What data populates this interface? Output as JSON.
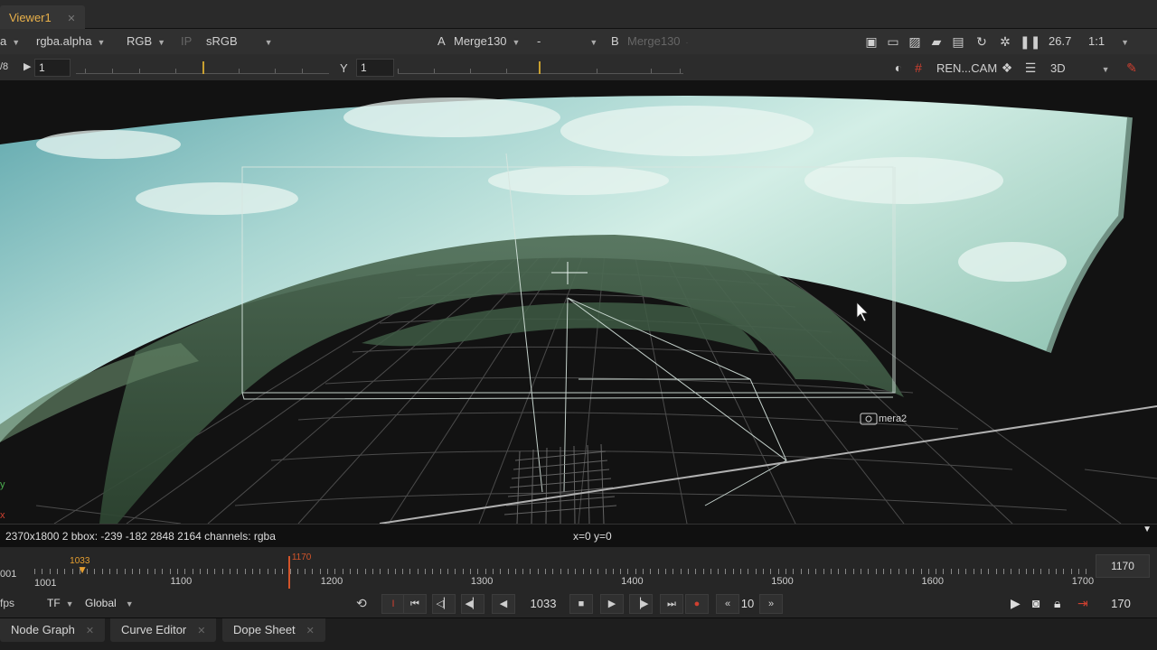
{
  "tab": {
    "title": "Viewer1",
    "close": "✕"
  },
  "toolbar1": {
    "channel_left": "a",
    "channels": "rgba.alpha",
    "display": "RGB",
    "ip": "IP",
    "lut": "sRGB",
    "a_label": "A",
    "a_input": "Merge130",
    "mid_value": "-",
    "b_label": "B",
    "b_input": "Merge130",
    "zoom": "26.7",
    "ratio": "1:1"
  },
  "toolbar2": {
    "gain_label": "/8",
    "gain_value": "1",
    "gamma_label": "Y",
    "gamma_value": "1",
    "render_label": "REN...CAM",
    "view_mode": "3D"
  },
  "viewer": {
    "camera_label": "mera2"
  },
  "infobar": {
    "format": "2370x1800 2  bbox: -239 -182 2848 2164 channels: rgba",
    "coords": "x=0 y=0"
  },
  "timeline": {
    "start_left": "001",
    "start": "1001",
    "in_point": "1033",
    "current": "1170",
    "labels": [
      "1100",
      "1200",
      "1300",
      "1400",
      "1500",
      "1600",
      "1700"
    ],
    "end": "1170",
    "fps_label": "fps",
    "tf": "TF",
    "scope": "Global",
    "frame": "1033",
    "step": "10",
    "end_frame": "170"
  },
  "panels": {
    "node_graph": "Node Graph",
    "curve_editor": "Curve Editor",
    "dope_sheet": "Dope Sheet"
  },
  "colors": {
    "accent": "#e8b04a",
    "playhead": "#d2542a",
    "in_point": "#e8a030"
  }
}
